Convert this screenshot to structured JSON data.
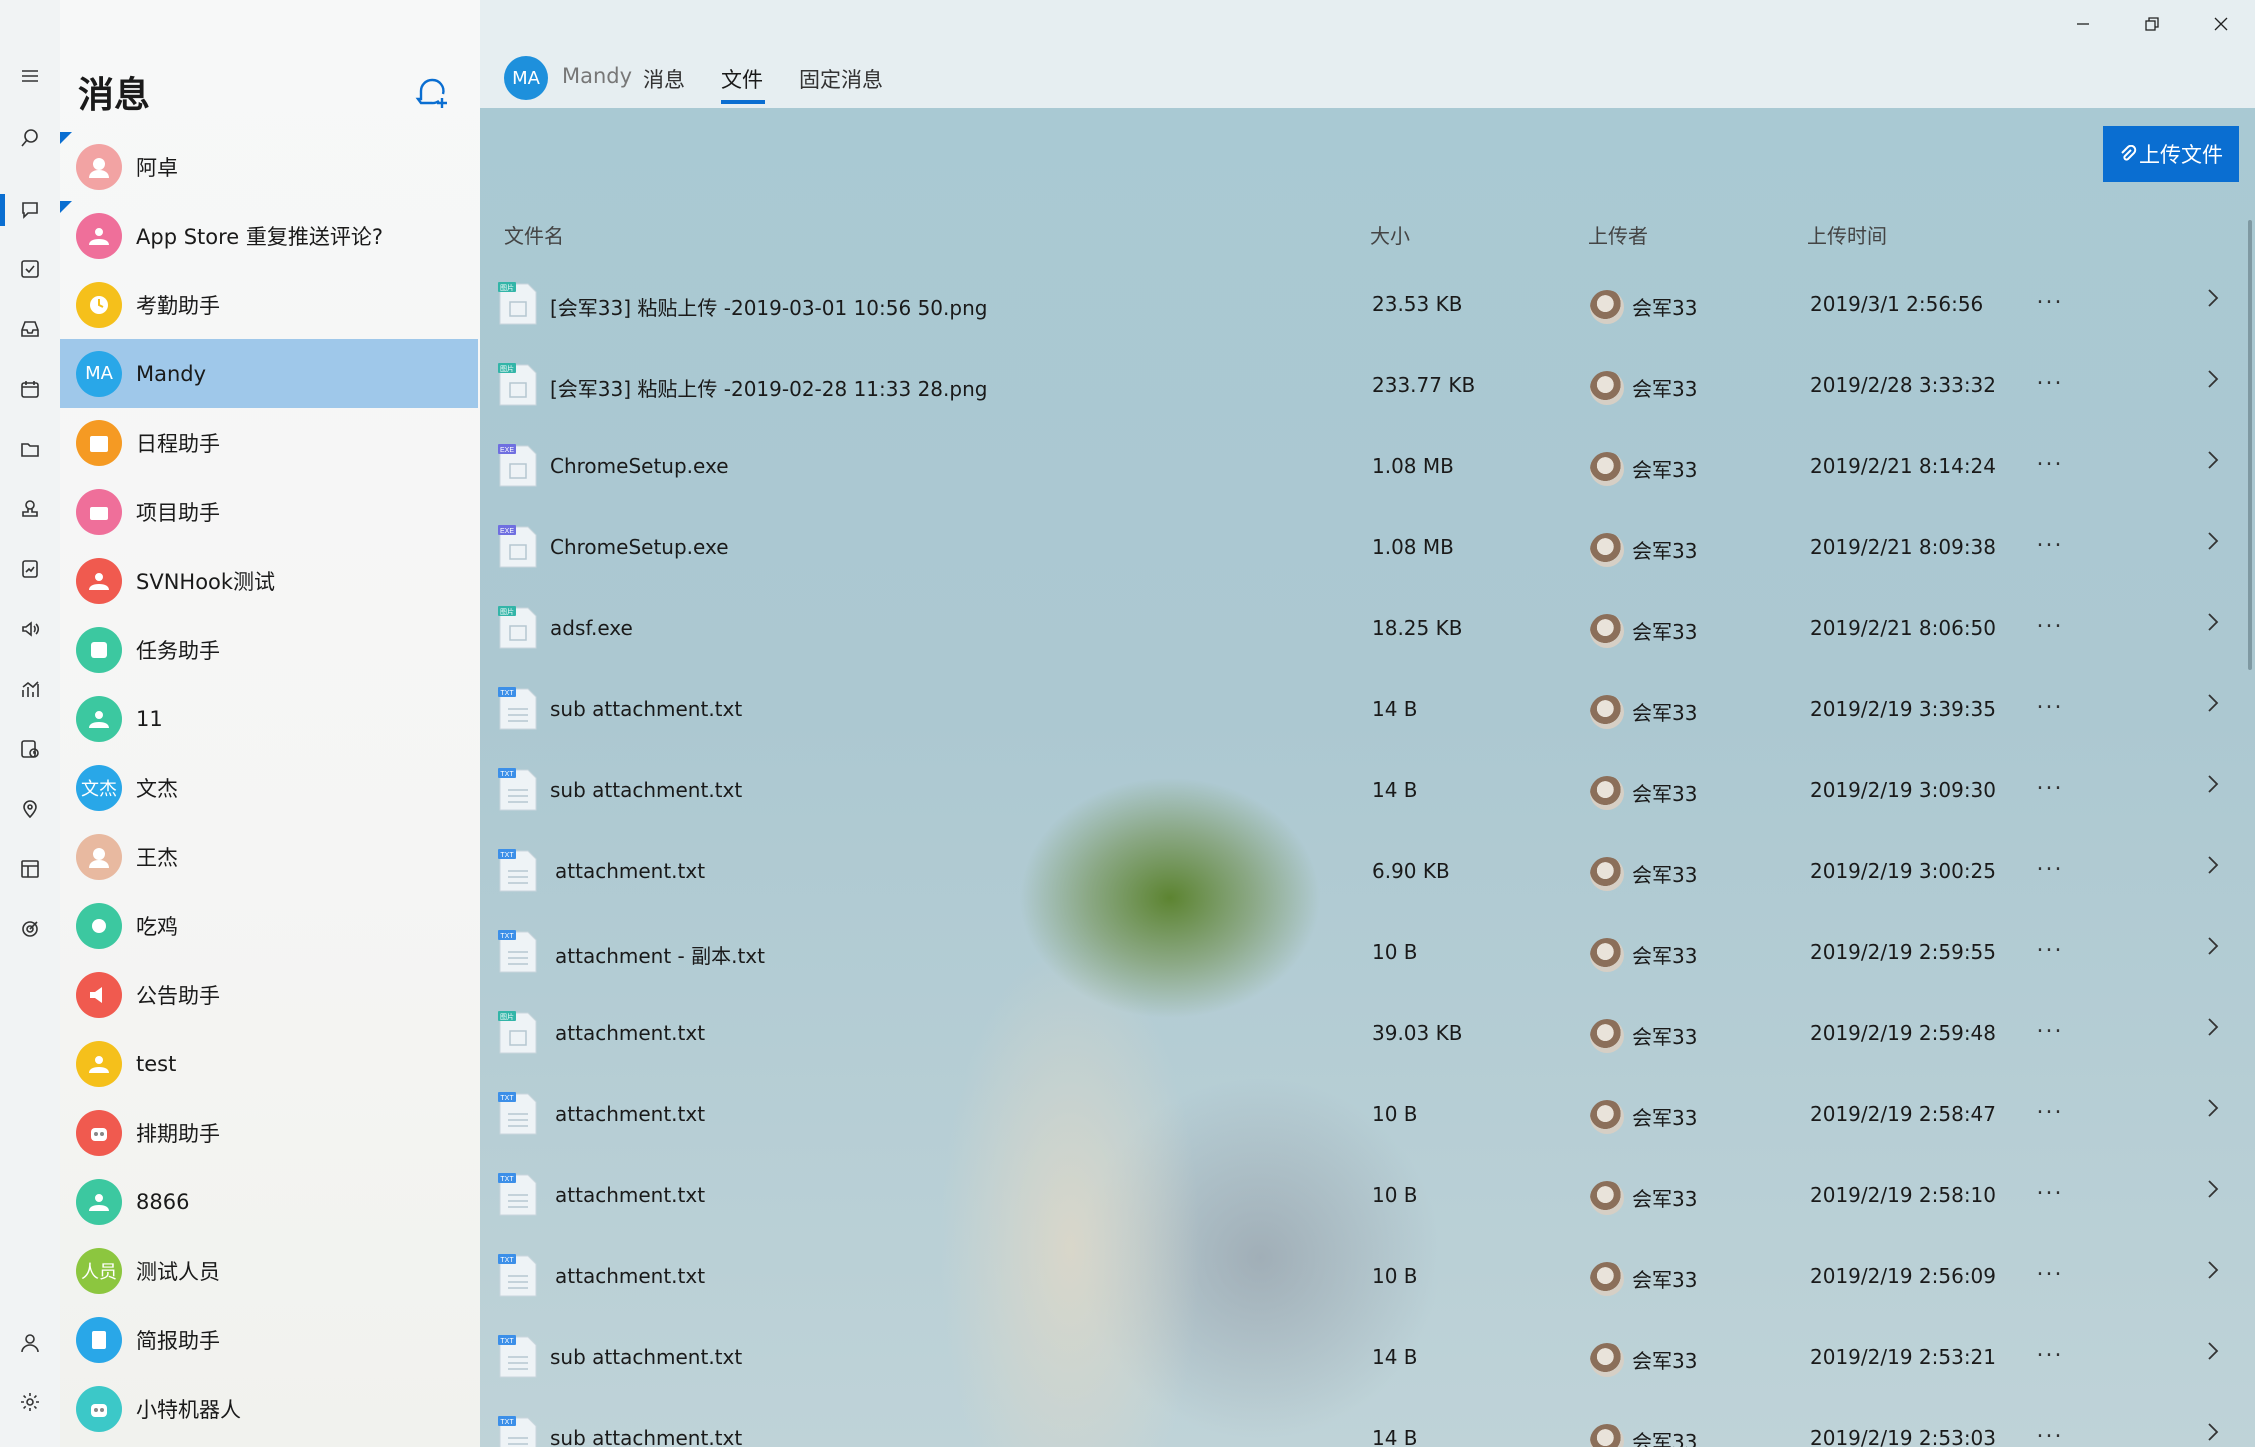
{
  "rail": {
    "items": [
      "menu-icon",
      "search-icon",
      "chat-icon",
      "checkbox-icon",
      "inbox-icon",
      "calendar-icon",
      "folder-icon",
      "stamp-icon",
      "report-icon",
      "speaker-icon",
      "chart-icon",
      "schedule-icon",
      "location-icon",
      "layout-icon",
      "target-icon",
      "user-icon",
      "gear-icon"
    ],
    "active": "chat-icon",
    "accent": "#0a6ed1"
  },
  "sidebar": {
    "title": "消息",
    "new_chat_icon": "new-chat-icon",
    "items": [
      {
        "label": "阿卓",
        "avatar_text": "",
        "avatar_type": "photo",
        "color": "#f2a3a3",
        "unread": true
      },
      {
        "label": "App Store 重复推送评论?",
        "avatar_text": "",
        "avatar_type": "group",
        "color": "#ef6f9a",
        "unread": true
      },
      {
        "label": "考勤助手",
        "avatar_text": "",
        "avatar_type": "clock",
        "color": "#f5c01b",
        "unread": false
      },
      {
        "label": "Mandy",
        "avatar_text": "MA",
        "avatar_type": "text",
        "color": "#29a7e8",
        "unread": false,
        "selected": true
      },
      {
        "label": "日程助手",
        "avatar_text": "",
        "avatar_type": "calendar",
        "color": "#f59a23",
        "unread": false
      },
      {
        "label": "项目助手",
        "avatar_text": "",
        "avatar_type": "box",
        "color": "#ef6f9a",
        "unread": false
      },
      {
        "label": "SVNHook测试",
        "avatar_text": "",
        "avatar_type": "group",
        "color": "#f05a4f",
        "unread": false
      },
      {
        "label": "任务助手",
        "avatar_text": "",
        "avatar_type": "check",
        "color": "#3cc8a0",
        "unread": false
      },
      {
        "label": "11",
        "avatar_text": "",
        "avatar_type": "group",
        "color": "#3cc8a0",
        "unread": false
      },
      {
        "label": "文杰",
        "avatar_text": "文杰",
        "avatar_type": "text",
        "color": "#29a7e8",
        "unread": false
      },
      {
        "label": "王杰",
        "avatar_text": "",
        "avatar_type": "photo",
        "color": "#e8b9a0",
        "unread": false
      },
      {
        "label": "吃鸡",
        "avatar_text": "",
        "avatar_type": "gear",
        "color": "#3cc8a0",
        "unread": false
      },
      {
        "label": "公告助手",
        "avatar_text": "",
        "avatar_type": "speaker",
        "color": "#f05a4f",
        "unread": false
      },
      {
        "label": "test",
        "avatar_text": "",
        "avatar_type": "group",
        "color": "#f5c01b",
        "unread": false
      },
      {
        "label": "排期助手",
        "avatar_text": "",
        "avatar_type": "robot",
        "color": "#f05a4f",
        "unread": false
      },
      {
        "label": "8866",
        "avatar_text": "",
        "avatar_type": "group",
        "color": "#3cc8a0",
        "unread": false
      },
      {
        "label": "测试人员",
        "avatar_text": "人员",
        "avatar_type": "text",
        "color": "#8cc63f",
        "unread": false
      },
      {
        "label": "简报助手",
        "avatar_text": "",
        "avatar_type": "report",
        "color": "#29a7e8",
        "unread": false
      },
      {
        "label": "小特机器人",
        "avatar_text": "",
        "avatar_type": "robot",
        "color": "#3cc8c8",
        "unread": false
      }
    ]
  },
  "header": {
    "avatar_text": "MA",
    "name": "Mandy",
    "tabs": [
      {
        "label": "消息",
        "active": false
      },
      {
        "label": "文件",
        "active": true
      },
      {
        "label": "固定消息",
        "active": false
      }
    ]
  },
  "window_controls": [
    "minimize-icon",
    "restore-icon",
    "close-icon"
  ],
  "files": {
    "upload_label": "上传文件",
    "columns": {
      "name": "文件名",
      "size": "大小",
      "uploader": "上传者",
      "time": "上传时间"
    },
    "rows": [
      {
        "type": "图片",
        "name": "[会军33] 粘贴上传 -2019-03-01 10:56 50.png",
        "size": "23.53 KB",
        "uploader": "会军33",
        "time": "2019/3/1 2:56:56"
      },
      {
        "type": "图片",
        "name": "[会军33] 粘贴上传 -2019-02-28 11:33 28.png",
        "size": "233.77 KB",
        "uploader": "会军33",
        "time": "2019/2/28 3:33:32"
      },
      {
        "type": "EXE",
        "name": "ChromeSetup.exe",
        "size": "1.08 MB",
        "uploader": "会军33",
        "time": "2019/2/21 8:14:24"
      },
      {
        "type": "EXE",
        "name": "ChromeSetup.exe",
        "size": "1.08 MB",
        "uploader": "会军33",
        "time": "2019/2/21 8:09:38"
      },
      {
        "type": "图片",
        "name": "adsf.exe",
        "size": "18.25 KB",
        "uploader": "会军33",
        "time": "2019/2/21 8:06:50"
      },
      {
        "type": "TXT",
        "name": "sub attachment.txt",
        "size": "14 B",
        "uploader": "会军33",
        "time": "2019/2/19 3:39:35"
      },
      {
        "type": "TXT",
        "name": "sub attachment.txt",
        "size": "14 B",
        "uploader": "会军33",
        "time": "2019/2/19 3:09:30"
      },
      {
        "type": "TXT",
        "name": "attachment.txt",
        "size": "6.90 KB",
        "uploader": "会军33",
        "time": "2019/2/19 3:00:25"
      },
      {
        "type": "TXT",
        "name": "attachment - 副本.txt",
        "size": "10 B",
        "uploader": "会军33",
        "time": "2019/2/19 2:59:55"
      },
      {
        "type": "图片",
        "name": "attachment.txt",
        "size": "39.03 KB",
        "uploader": "会军33",
        "time": "2019/2/19 2:59:48"
      },
      {
        "type": "TXT",
        "name": "attachment.txt",
        "size": "10 B",
        "uploader": "会军33",
        "time": "2019/2/19 2:58:47"
      },
      {
        "type": "TXT",
        "name": "attachment.txt",
        "size": "10 B",
        "uploader": "会军33",
        "time": "2019/2/19 2:58:10"
      },
      {
        "type": "TXT",
        "name": "attachment.txt",
        "size": "10 B",
        "uploader": "会军33",
        "time": "2019/2/19 2:56:09"
      },
      {
        "type": "TXT",
        "name": "sub attachment.txt",
        "size": "14 B",
        "uploader": "会军33",
        "time": "2019/2/19 2:53:21"
      },
      {
        "type": "TXT",
        "name": "sub attachment.txt",
        "size": "14 B",
        "uploader": "会军33",
        "time": "2019/2/19 2:53:03"
      }
    ],
    "more_label": "...",
    "type_colors": {
      "图片": "#33b5a8",
      "EXE": "#6f6fe0",
      "TXT": "#3c8fe8"
    }
  }
}
